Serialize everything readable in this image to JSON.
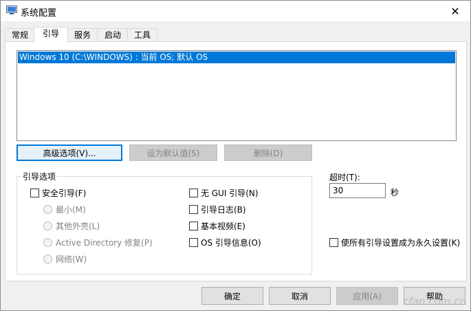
{
  "window": {
    "title": "系统配置",
    "icon": "msconfig-icon"
  },
  "tabs": [
    "常规",
    "引导",
    "服务",
    "启动",
    "工具"
  ],
  "boot_list": {
    "items": [
      "Windows 10 (C:\\WINDOWS) : 当前 OS; 默认 OS"
    ]
  },
  "buttons": {
    "advanced": "高级选项(V)...",
    "set_default": "设为默认值(S)",
    "delete": "删除(D)"
  },
  "boot_options": {
    "group_label": "引导选项",
    "safe_boot": "安全引导(F)",
    "minimal": "最小(M)",
    "alternate_shell": "其他外壳(L)",
    "active_directory": "Active Directory 修复(P)",
    "network": "网络(W)",
    "no_gui": "无 GUI 引导(N)",
    "boot_log": "引导日志(B)",
    "base_video": "基本视频(E)",
    "os_boot_info": "OS 引导信息(O)"
  },
  "timeout": {
    "label": "超时(T):",
    "value": "30",
    "unit": "秒"
  },
  "make_permanent": "使所有引导设置成为永久设置(K)",
  "footer": {
    "ok": "确定",
    "cancel": "取消",
    "apply": "应用(A)",
    "help": "帮助"
  },
  "watermark": "cfan.com.cn",
  "colors": {
    "selection": "#0078d7",
    "focus_border": "#0078d7"
  }
}
